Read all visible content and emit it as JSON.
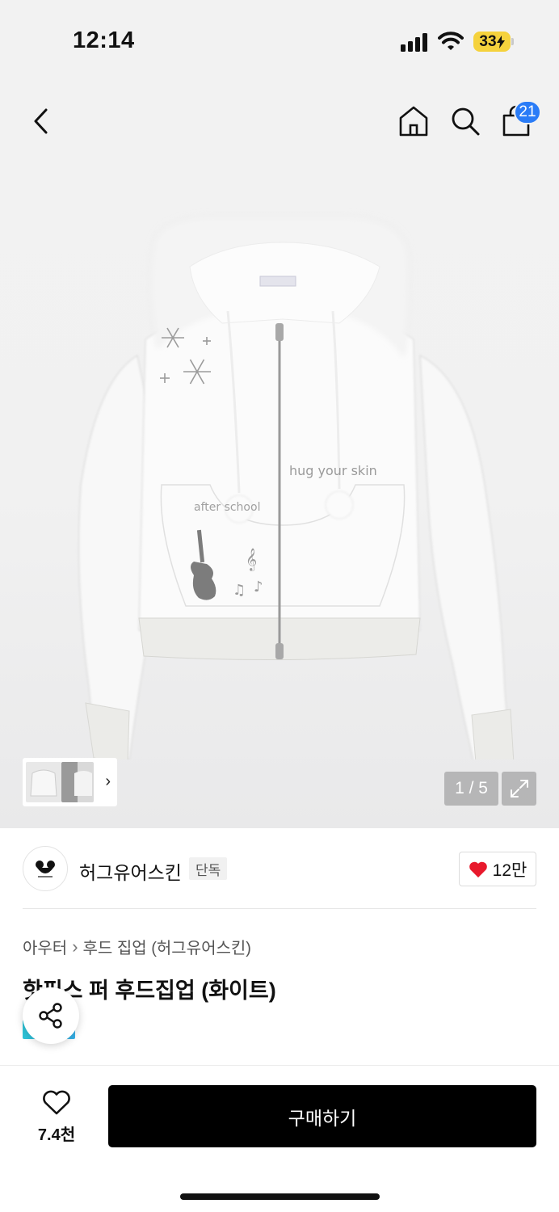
{
  "status_bar": {
    "time": "12:14",
    "battery": "33"
  },
  "nav": {
    "cart_count": "21"
  },
  "gallery": {
    "page_counter": "1 / 5"
  },
  "brand": {
    "name": "허그유어스킨",
    "badge": "단독",
    "likes": "12만"
  },
  "product": {
    "breadcrumb": [
      "아우터",
      "후드 집업 (허그유어스킨)"
    ],
    "title": "핫핑스 퍼 후드집업 (화이트)",
    "artwork_text": [
      "hug your skin",
      "after school"
    ]
  },
  "bottom_bar": {
    "wish_count": "7.4천",
    "buy_label": "구매하기"
  },
  "colors": {
    "accent_blue": "#2a7cf7",
    "battery_yellow": "#f5d23d",
    "heart_red": "#e8192c",
    "buy_black": "#000000"
  },
  "icons": [
    "back-icon",
    "home-icon",
    "search-icon",
    "cart-icon",
    "expand-icon",
    "heart-icon",
    "share-icon",
    "chevron-right-icon"
  ]
}
